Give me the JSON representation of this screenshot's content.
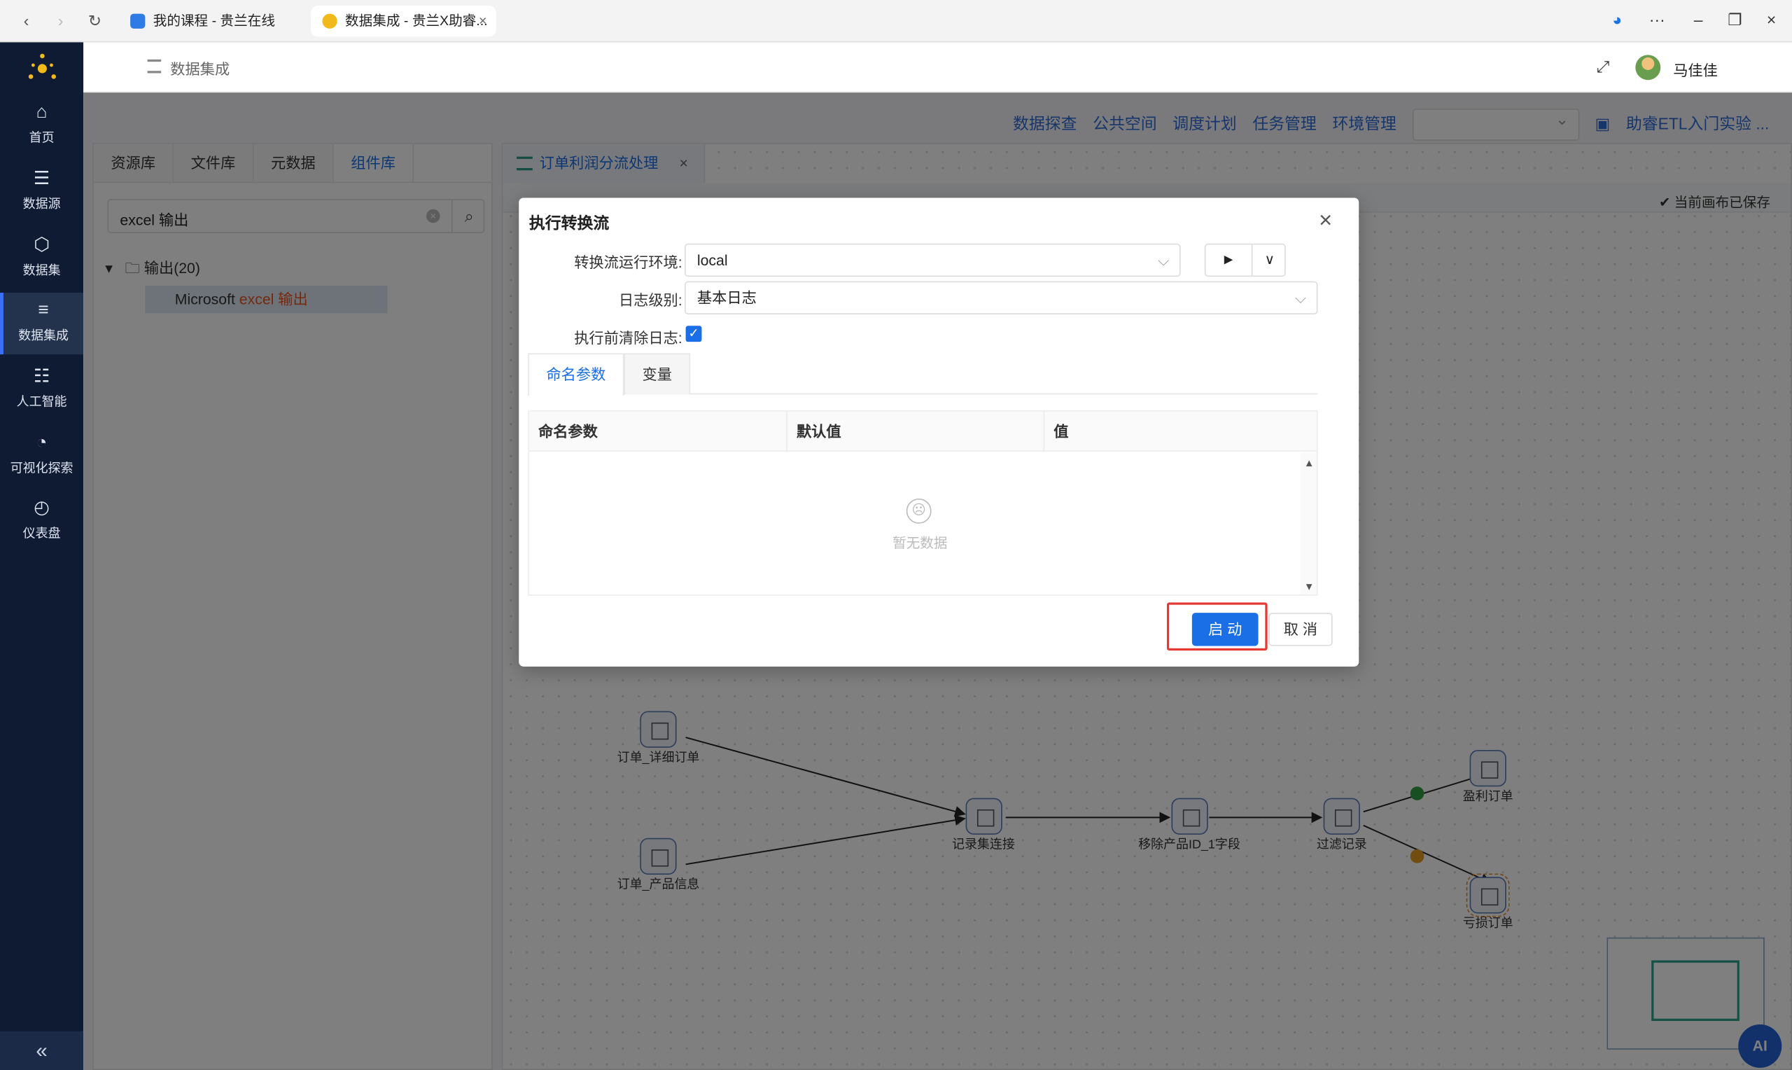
{
  "browser": {
    "tabs": [
      {
        "label": "我的课程 - 贵兰在线"
      },
      {
        "label": "数据集成 - 贵兰X助睿..."
      }
    ]
  },
  "sidebar": {
    "items": [
      {
        "label": "首页",
        "icon": "home-icon"
      },
      {
        "label": "数据源",
        "icon": "database-icon"
      },
      {
        "label": "数据集",
        "icon": "cube-icon"
      },
      {
        "label": "数据集成",
        "icon": "server-icon"
      },
      {
        "label": "人工智能",
        "icon": "ai-icon"
      },
      {
        "label": "可视化探索",
        "icon": "pie-chart-icon"
      },
      {
        "label": "仪表盘",
        "icon": "gauge-icon"
      }
    ],
    "collapse": "«"
  },
  "header": {
    "breadcrumb": "数据集成",
    "user": "马佳佳"
  },
  "menu": {
    "links": [
      "数据探查",
      "公共空间",
      "调度计划",
      "任务管理",
      "环境管理"
    ],
    "project": "助睿ETL入门实验 ..."
  },
  "left_panel": {
    "tabs": [
      "资源库",
      "文件库",
      "元数据",
      "组件库"
    ],
    "search_value": "excel 输出",
    "tree_root": "输出(20)",
    "tree_leaf_prefix": "Microsoft ",
    "tree_leaf_hl": "excel 输出"
  },
  "canvas": {
    "tab_title": "订单利润分流处理",
    "saved_status": "当前画布已保存",
    "nodes": [
      "订单_详细订单",
      "订单_产品信息",
      "记录集连接",
      "移除产品ID_1字段",
      "过滤记录",
      "盈利订单",
      "亏损订单"
    ],
    "ai_label": "AI"
  },
  "dialog": {
    "title": "执行转换流",
    "env_label": "转换流运行环境:",
    "env_value": "local",
    "log_label": "日志级别:",
    "log_value": "基本日志",
    "clear_label": "执行前清除日志:",
    "tabs": [
      "命名参数",
      "变量"
    ],
    "columns": [
      "命名参数",
      "默认值",
      "值"
    ],
    "empty_text": "暂无数据",
    "start": "启 动",
    "cancel": "取 消"
  }
}
